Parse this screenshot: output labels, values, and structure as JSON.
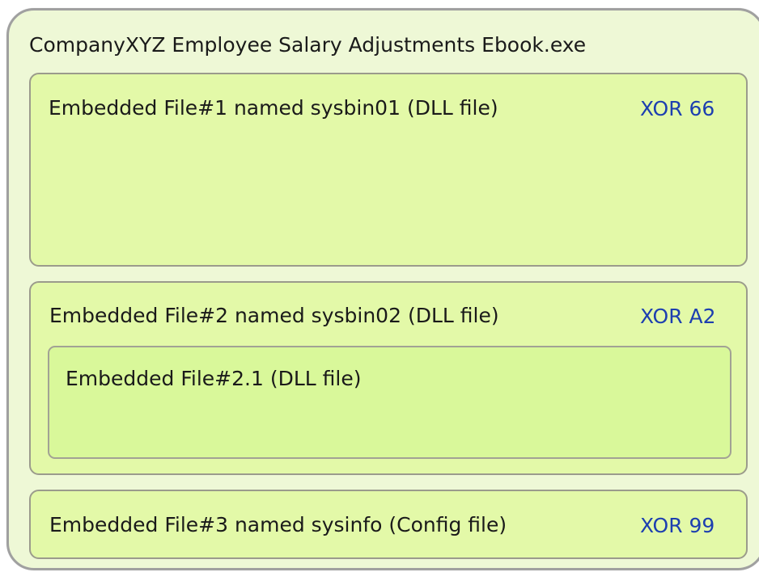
{
  "outer": {
    "title": "CompanyXYZ Employee Salary Adjustments Ebook.exe"
  },
  "files": [
    {
      "label": "Embedded File#1 named sysbin01 (DLL file)",
      "xor": "XOR 66"
    },
    {
      "label": "Embedded File#2 named sysbin02 (DLL file)",
      "xor": "XOR A2",
      "child": {
        "label": "Embedded File#2.1 (DLL file)"
      }
    },
    {
      "label": "Embedded File#3 named sysinfo (Config file)",
      "xor": "XOR 99"
    }
  ],
  "colors": {
    "outer_fill": "#eef8d6",
    "box_fill": "#e3f9a8",
    "inner_fill": "#d9f89a",
    "xor_text": "#1d3fb0"
  }
}
